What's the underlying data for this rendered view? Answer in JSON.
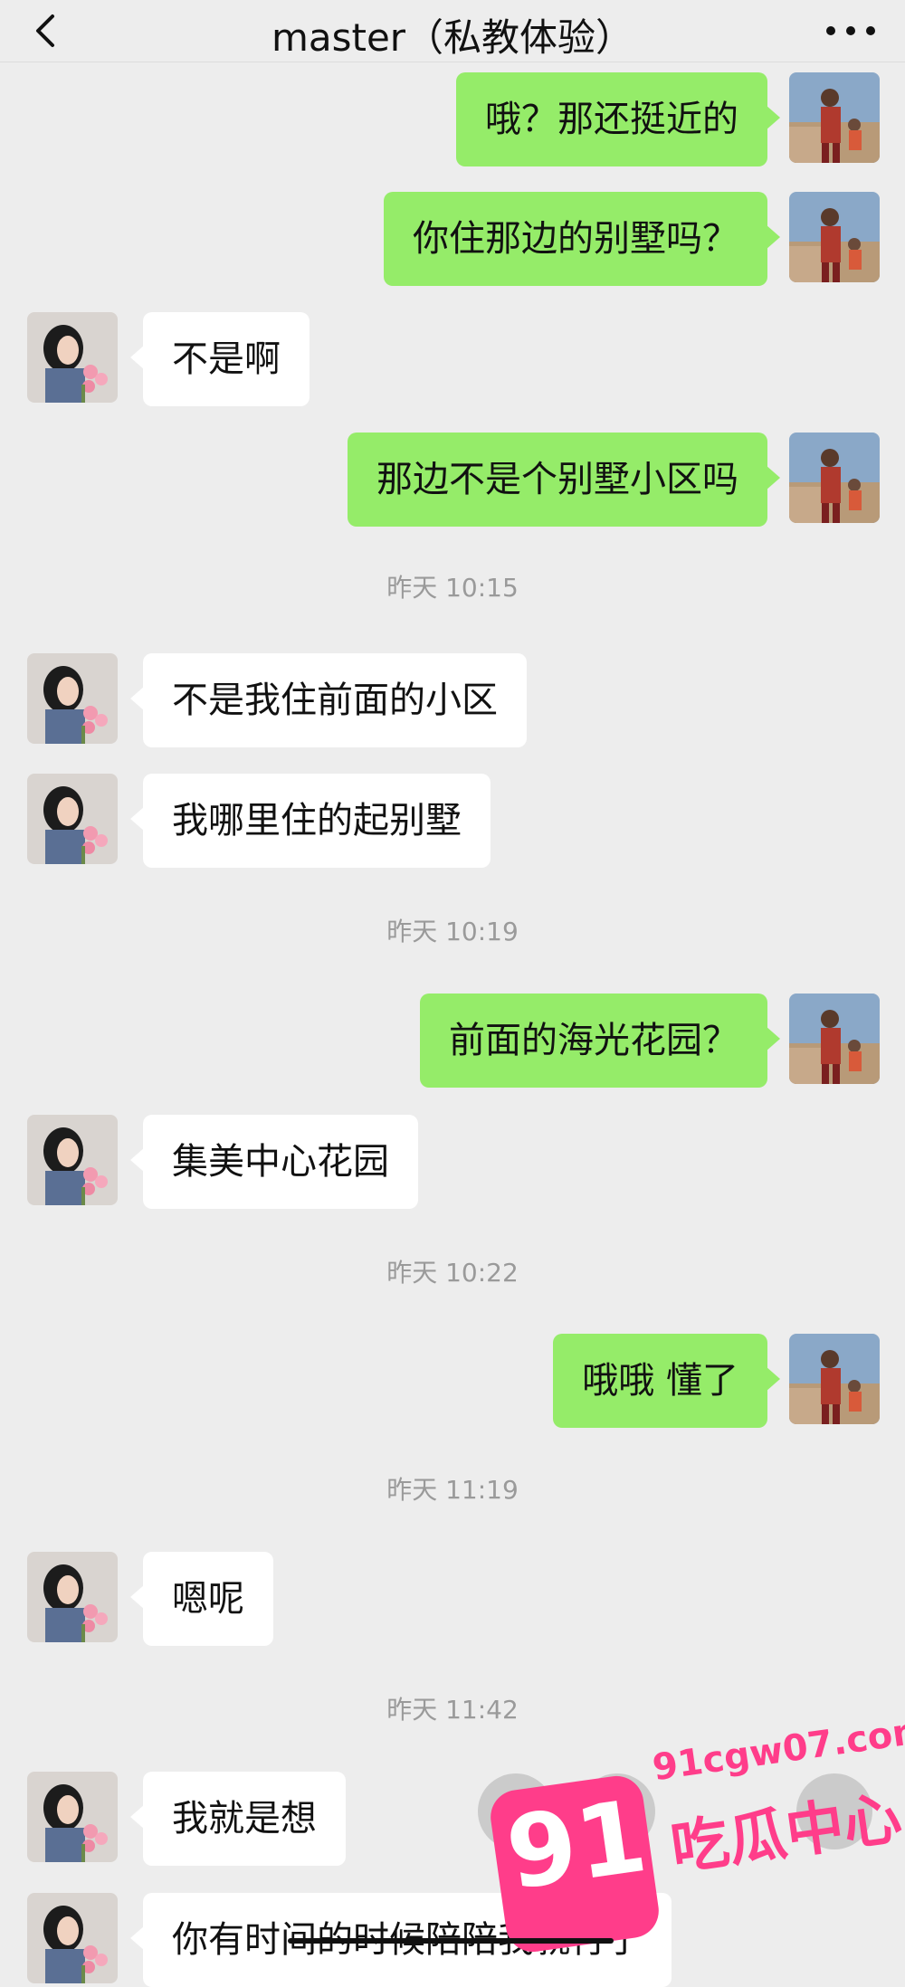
{
  "header": {
    "title": "master（私教体验）",
    "back_icon": "chevron-left-icon",
    "more_icon": "more-dots-icon"
  },
  "colors": {
    "sent_bubble": "#95ec69",
    "received_bubble": "#ffffff",
    "background": "#ededed",
    "watermark": "#ff3d8a"
  },
  "messages": [
    {
      "type": "sent",
      "text": "哦？那还挺近的"
    },
    {
      "type": "sent",
      "text": "你住那边的别墅吗？"
    },
    {
      "type": "received",
      "text": "不是啊"
    },
    {
      "type": "sent",
      "text": "那边不是个别墅小区吗"
    },
    {
      "type": "time",
      "text": "昨天 10:15"
    },
    {
      "type": "received",
      "text": "不是我住前面的小区"
    },
    {
      "type": "received",
      "text": "我哪里住的起别墅"
    },
    {
      "type": "time",
      "text": "昨天 10:19"
    },
    {
      "type": "sent",
      "text": "前面的海光花园？"
    },
    {
      "type": "received",
      "text": "集美中心花园"
    },
    {
      "type": "time",
      "text": "昨天 10:22"
    },
    {
      "type": "sent",
      "text": "哦哦  懂了"
    },
    {
      "type": "time",
      "text": "昨天 11:19"
    },
    {
      "type": "received",
      "text": "嗯呢"
    },
    {
      "type": "time",
      "text": "昨天 11:42"
    },
    {
      "type": "received",
      "text": "我就是想"
    },
    {
      "type": "received",
      "text": "你有时间的时候陪陪我就行了"
    }
  ],
  "watermark": {
    "number": "91",
    "url": "91cgw07.com",
    "name": "吃瓜中心"
  }
}
